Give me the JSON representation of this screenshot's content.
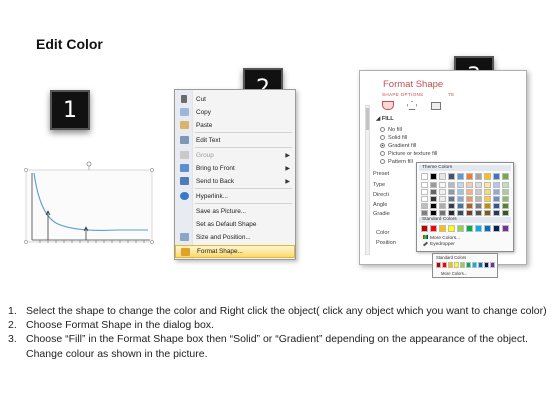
{
  "title": "Edit Color",
  "badges": {
    "one": "1",
    "two": "2",
    "three": "3"
  },
  "context_menu": {
    "items": [
      {
        "label": "Cut",
        "icon": "scissors-icon",
        "submenu": false,
        "disabled": false
      },
      {
        "label": "Copy",
        "icon": "copy-icon",
        "submenu": false,
        "disabled": false
      },
      {
        "label": "Paste",
        "icon": "paste-icon",
        "submenu": false,
        "disabled": false
      },
      {
        "label": "Edit Text",
        "icon": "edit-text-icon",
        "submenu": false,
        "disabled": false
      },
      {
        "label": "Group",
        "icon": "group-icon",
        "submenu": true,
        "disabled": true
      },
      {
        "label": "Bring to Front",
        "icon": "bring-front-icon",
        "submenu": true,
        "disabled": false
      },
      {
        "label": "Send to Back",
        "icon": "send-back-icon",
        "submenu": true,
        "disabled": false
      },
      {
        "label": "Hyperlink...",
        "icon": "hyperlink-icon",
        "submenu": false,
        "disabled": false
      },
      {
        "label": "Save as Picture...",
        "icon": "",
        "submenu": false,
        "disabled": false
      },
      {
        "label": "Set as Default Shape",
        "icon": "",
        "submenu": false,
        "disabled": false
      },
      {
        "label": "Size and Position...",
        "icon": "size-position-icon",
        "submenu": false,
        "disabled": false
      },
      {
        "label": "Format Shape...",
        "icon": "format-shape-icon",
        "submenu": false,
        "disabled": false,
        "highlighted": true
      }
    ]
  },
  "format_shape": {
    "title": "Format Shape",
    "tab_shape": "SHAPE OPTIONS",
    "tab_text": "TE",
    "section_fill": "FILL",
    "fill_options": [
      "No fill",
      "Solid fill",
      "Gradient fill",
      "Picture or texture fill",
      "Pattern fill"
    ],
    "selected_fill": "Gradient fill",
    "row_labels": [
      "Preset",
      "Type",
      "Directi",
      "Angle",
      "Gradie"
    ],
    "color_label": "Color",
    "position_label": "Position",
    "position_value": "0%"
  },
  "palette": {
    "theme_header": "Theme Colors",
    "standard_header": "Standard Colors",
    "more_colors": "More Colors...",
    "eyedropper": "Eyedropper",
    "theme_top": [
      "#ffffff",
      "#000000",
      "#e7e6e6",
      "#44546a",
      "#5b9bd5",
      "#ed7d31",
      "#a5a5a5",
      "#ffc000",
      "#4472c4",
      "#70ad47"
    ],
    "standard": [
      "#c00000",
      "#ff0000",
      "#ffc000",
      "#ffff00",
      "#92d050",
      "#00b050",
      "#00b0f0",
      "#0070c0",
      "#002060",
      "#7030a0"
    ]
  },
  "palette_mini": {
    "header": "Standard Colors",
    "more_colors": "More Colors..."
  },
  "instructions": [
    {
      "num": "1.",
      "text": "Select the shape to change the color and Right click the object( click any object which you want to change color)"
    },
    {
      "num": "2.",
      "text": "Choose Format Shape in the dialog box."
    },
    {
      "num": "3.",
      "text": "Choose “Fill” in the Format Shape box then “Solid” or “Gradient” depending on the appearance of the object. Change colour as shown in the picture."
    }
  ]
}
